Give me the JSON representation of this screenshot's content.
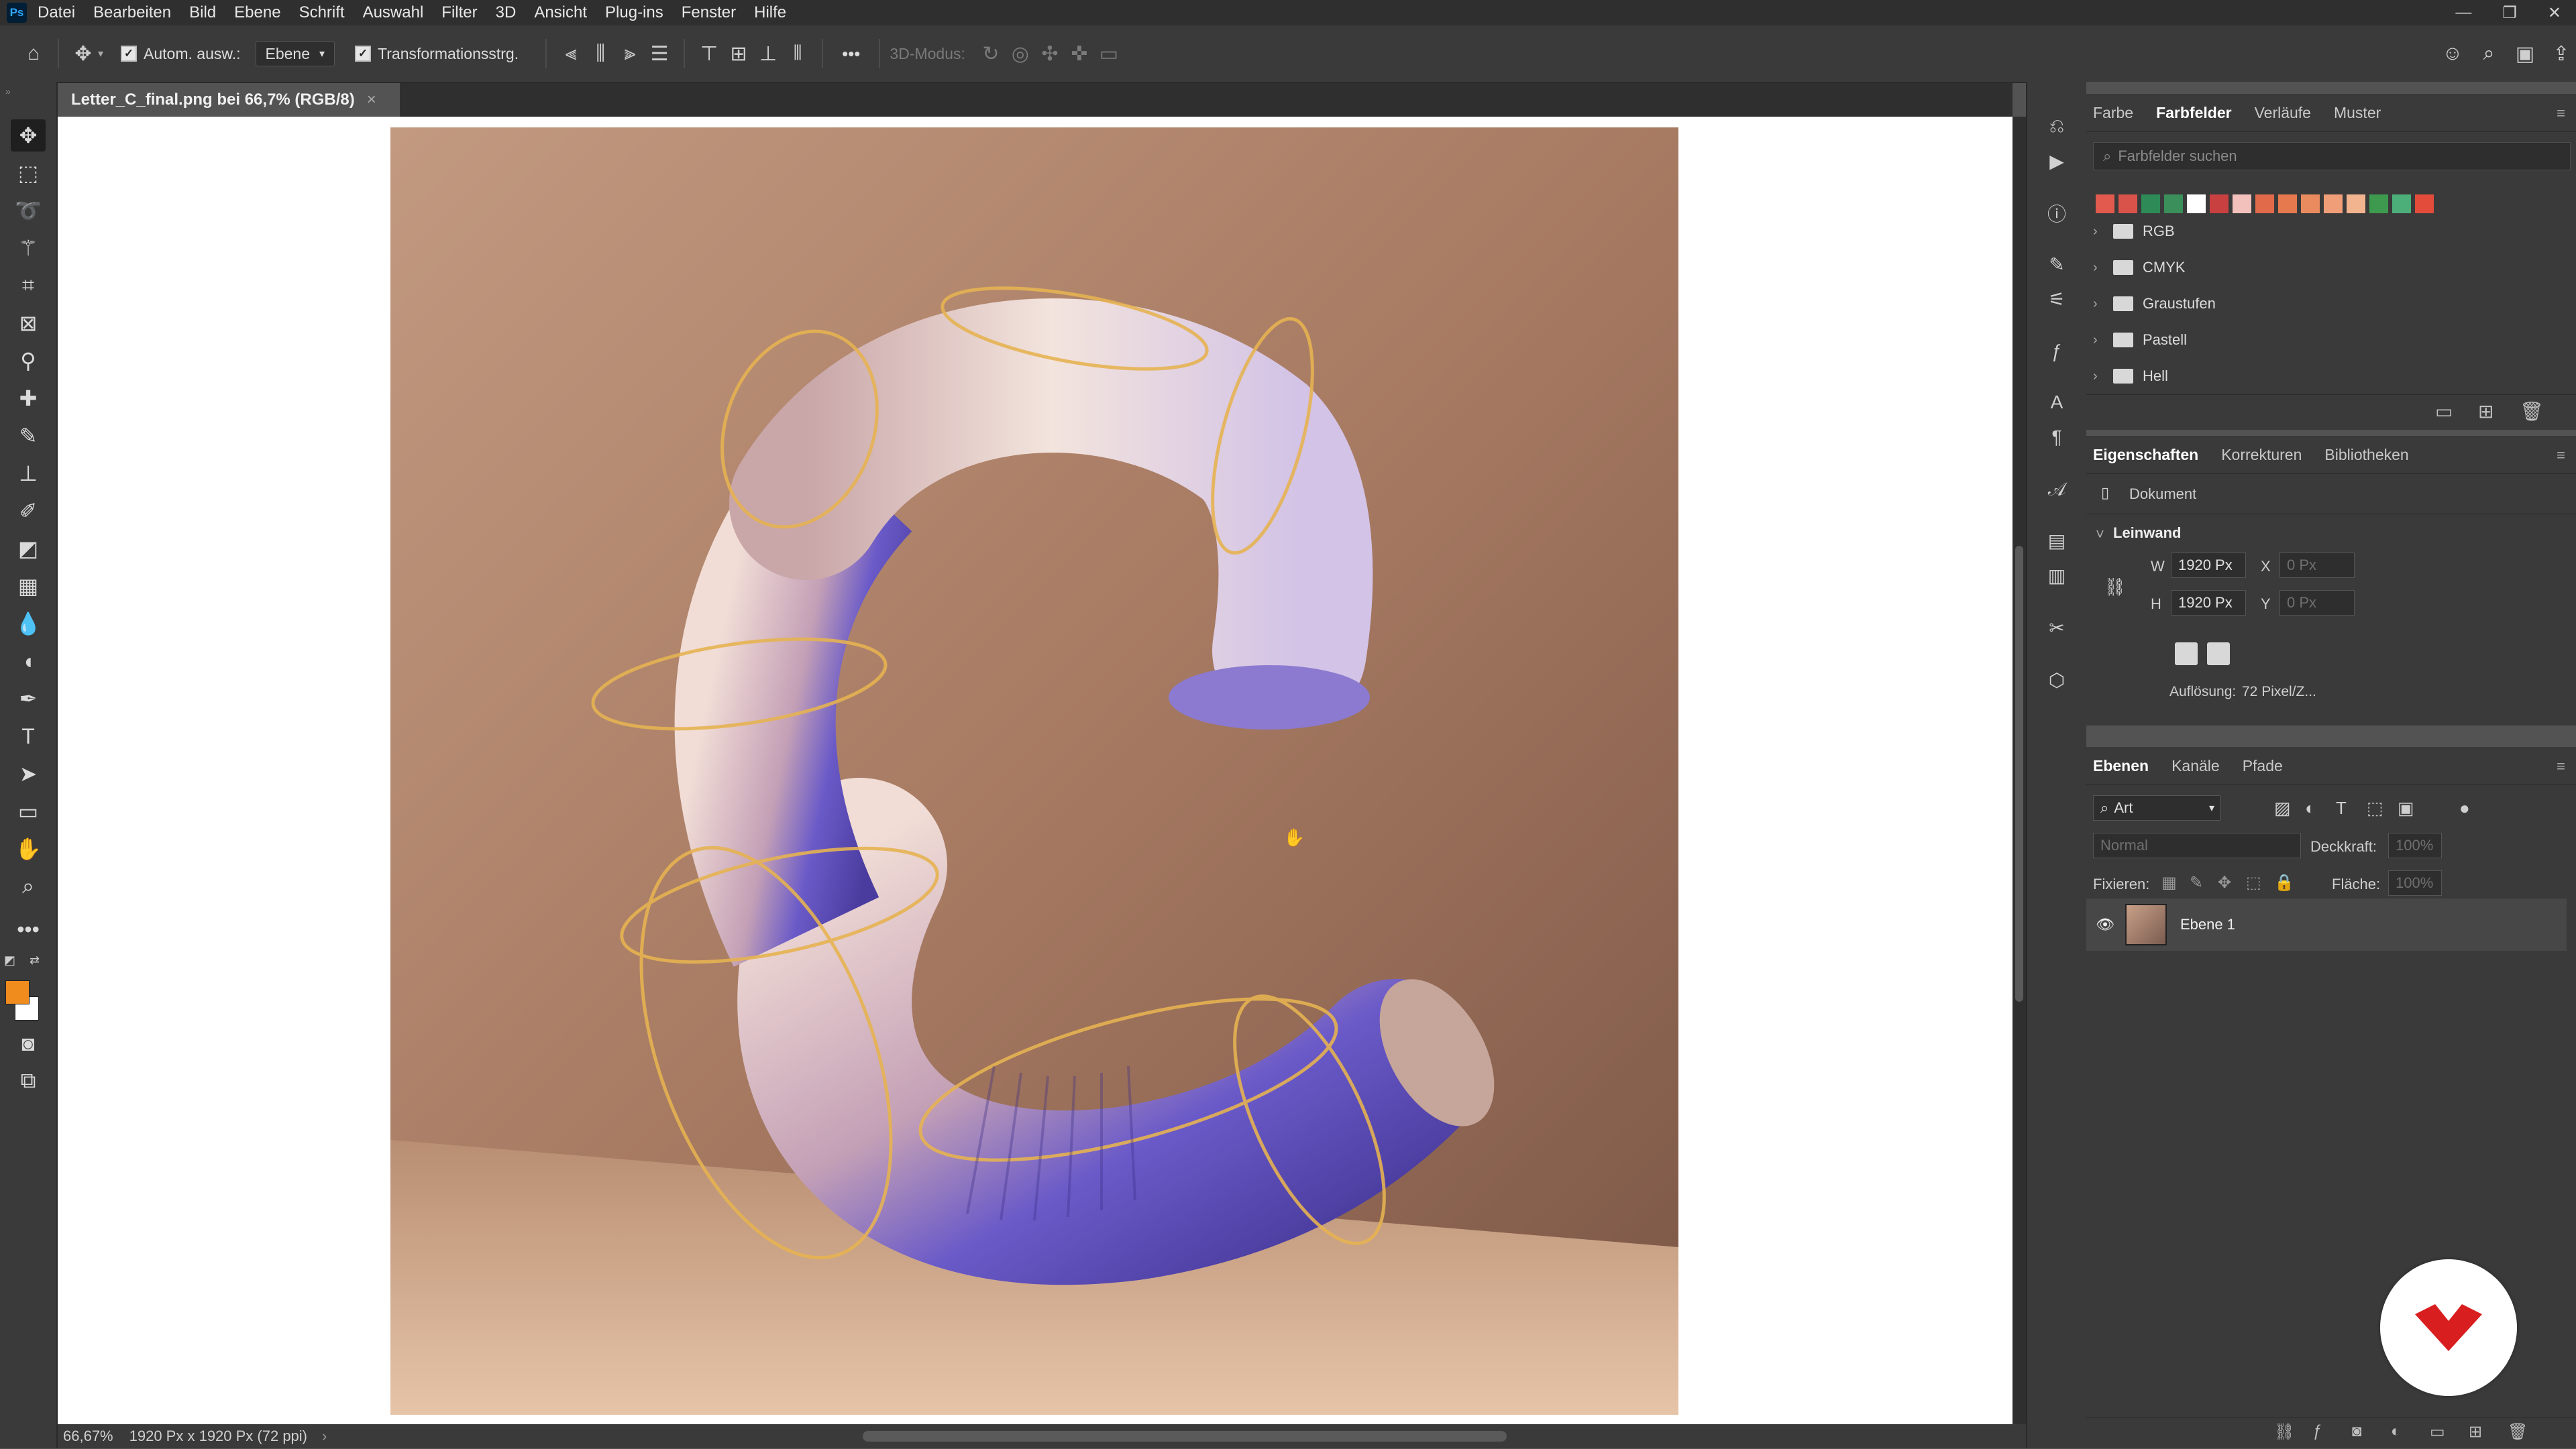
{
  "menubar": {
    "items": [
      "Datei",
      "Bearbeiten",
      "Bild",
      "Ebene",
      "Schrift",
      "Auswahl",
      "Filter",
      "3D",
      "Ansicht",
      "Plug-ins",
      "Fenster",
      "Hilfe"
    ],
    "app_icon": "Ps",
    "window_controls": [
      "—",
      "❐",
      "✕"
    ]
  },
  "options": {
    "auto_select_label": "Autom. ausw.:",
    "auto_select_target": "Ebene",
    "transform_label": "Transformationsstrg.",
    "more": "•••",
    "mode_3d_label": "3D-Modus:"
  },
  "document": {
    "tab_title": "Letter_C_final.png bei 66,7% (RGB/8)",
    "close": "×"
  },
  "status": {
    "zoom": "66,67%",
    "info": "1920 Px x 1920 Px (72 ppi)",
    "arrow": "›"
  },
  "swatches_panel": {
    "tabs": [
      "Farbe",
      "Farbfelder",
      "Verläufe",
      "Muster"
    ],
    "active_tab": "Farbfelder",
    "search_placeholder": "Farbfelder suchen",
    "swatch_colors": [
      "#e25a4e",
      "#d9534a",
      "#2e8b57",
      "#3a8f5a",
      "#ffffff",
      "#c94040",
      "#f2c1bc",
      "#e06a4a",
      "#e67a4e",
      "#e98b5e",
      "#f09e78",
      "#f2b48f",
      "#3e9a4e",
      "#4caf7a",
      "#e34b3a"
    ],
    "folders": [
      "RGB",
      "CMYK",
      "Graustufen",
      "Pastell",
      "Hell"
    ]
  },
  "properties_panel": {
    "tabs": [
      "Eigenschaften",
      "Korrekturen",
      "Bibliotheken"
    ],
    "active_tab": "Eigenschaften",
    "doc_label": "Dokument",
    "section": "Leinwand",
    "w_label": "W",
    "w_value": "1920 Px",
    "h_label": "H",
    "h_value": "1920 Px",
    "x_label": "X",
    "x_value": "0 Px",
    "y_label": "Y",
    "y_value": "0 Px",
    "resolution_label": "Auflösung:",
    "resolution_value": "72 Pixel/Z..."
  },
  "layers_panel": {
    "tabs": [
      "Ebenen",
      "Kanäle",
      "Pfade"
    ],
    "active_tab": "Ebenen",
    "filter_value": "Art",
    "blend_mode": "Normal",
    "opacity_label": "Deckkraft:",
    "opacity_value": "100%",
    "lock_label": "Fixieren:",
    "fill_label": "Fläche:",
    "fill_value": "100%",
    "layers": [
      {
        "name": "Ebene 1",
        "visible": true
      }
    ]
  },
  "colors": {
    "foreground": "#f08c1e",
    "background": "#ffffff",
    "badge_red": "#d81e1e"
  }
}
